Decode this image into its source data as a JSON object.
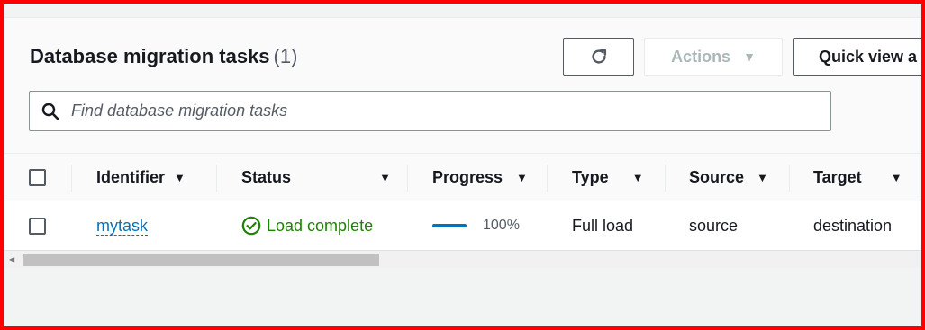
{
  "header": {
    "title": "Database migration tasks",
    "count": "(1)",
    "actions_label": "Actions",
    "quick_view_label": "Quick view a"
  },
  "search": {
    "placeholder": "Find database migration tasks"
  },
  "table": {
    "columns": [
      "Identifier",
      "Status",
      "Progress",
      "Type",
      "Source",
      "Target"
    ],
    "rows": [
      {
        "identifier": "mytask",
        "status": "Load complete",
        "progress": "100%",
        "progress_fraction": 1.0,
        "type": "Full load",
        "source": "source",
        "target": "destination"
      }
    ]
  },
  "colors": {
    "link": "#0073bb",
    "success": "#1d8102",
    "border_highlight": "#ff0000"
  },
  "icons": {
    "refresh": "refresh-icon",
    "search": "search-icon",
    "status": "check-circle-icon"
  }
}
